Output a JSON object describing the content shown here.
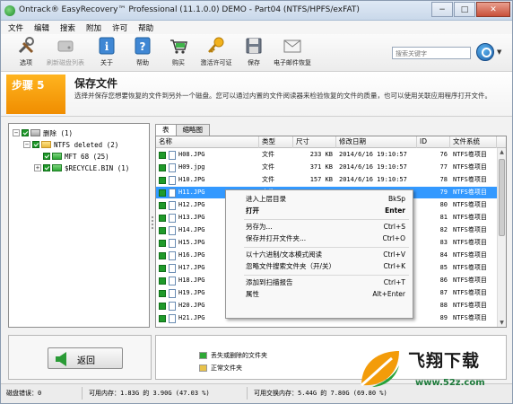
{
  "window": {
    "title": "Ontrack® EasyRecovery™ Professional (11.1.0.0) DEMO - Part04 (NTFS/HPFS/exFAT)",
    "min": "−",
    "max": "□",
    "close": "✕"
  },
  "menu": [
    "文件",
    "编辑",
    "搜索",
    "附加",
    "许可",
    "帮助"
  ],
  "toolbar": {
    "items": [
      {
        "label": "选项",
        "icon": "tools-icon"
      },
      {
        "label": "刷新磁盘列表",
        "icon": "refresh-disk-icon"
      },
      {
        "label": "关于",
        "icon": "info-icon"
      },
      {
        "label": "帮助",
        "icon": "help-icon"
      },
      {
        "label": "购买",
        "icon": "cart-icon"
      },
      {
        "label": "激活许可证",
        "icon": "key-icon"
      },
      {
        "label": "保存",
        "icon": "save-icon"
      },
      {
        "label": "电子邮件恢复",
        "icon": "email-icon"
      }
    ],
    "search_placeholder": "搜索关键字"
  },
  "step": {
    "badge": "步骤 5",
    "title": "保存文件",
    "description": "选择并保存您想要恢复的文件到另外一个磁盘。您可以通过内置的文件阅读器来检验恢复的文件的质量，也可以使用关联应用程序打开文件。"
  },
  "tree": [
    {
      "label": "删除 (1)",
      "expander": "−",
      "kind": "drive",
      "indent": 0
    },
    {
      "label": "NTFS deleted (2)",
      "expander": "−",
      "kind": "folder",
      "indent": 1
    },
    {
      "label": "MFT 68 (25)",
      "expander": "",
      "kind": "folder",
      "indent": 2
    },
    {
      "label": "$RECYCLE.BIN (1)",
      "expander": "+",
      "kind": "folder",
      "indent": 2
    }
  ],
  "tabs": [
    "表",
    "缩略图"
  ],
  "columns": [
    "名称",
    "类型",
    "尺寸",
    "修改日期",
    "ID",
    "文件系统"
  ],
  "rows": [
    {
      "name": "H08.JPG",
      "type": "文件",
      "size": "233 KB",
      "date": "2014/6/16 19:10:57",
      "id": "76",
      "fs": "NTFS卷项目"
    },
    {
      "name": "H09.jpg",
      "type": "文件",
      "size": "371 KB",
      "date": "2014/6/16 19:10:57",
      "id": "77",
      "fs": "NTFS卷项目"
    },
    {
      "name": "H10.JPG",
      "type": "文件",
      "size": "157 KB",
      "date": "2014/6/16 19:10:57",
      "id": "78",
      "fs": "NTFS卷项目"
    },
    {
      "name": "H11.JPG",
      "type": "文件",
      "size": "271 KB",
      "date": "2014/6/16 19:10:57",
      "id": "79",
      "fs": "NTFS卷项目"
    },
    {
      "name": "H12.JPG",
      "type": "",
      "size": "",
      "date": "",
      "id": "80",
      "fs": "NTFS卷项目"
    },
    {
      "name": "H13.JPG",
      "type": "",
      "size": "",
      "date": "",
      "id": "81",
      "fs": "NTFS卷项目"
    },
    {
      "name": "H14.JPG",
      "type": "",
      "size": "",
      "date": "",
      "id": "82",
      "fs": "NTFS卷项目"
    },
    {
      "name": "H15.JPG",
      "type": "",
      "size": "",
      "date": "",
      "id": "83",
      "fs": "NTFS卷项目"
    },
    {
      "name": "H16.JPG",
      "type": "",
      "size": "",
      "date": "",
      "id": "84",
      "fs": "NTFS卷项目"
    },
    {
      "name": "H17.JPG",
      "type": "",
      "size": "",
      "date": "",
      "id": "85",
      "fs": "NTFS卷项目"
    },
    {
      "name": "H18.JPG",
      "type": "",
      "size": "",
      "date": "",
      "id": "86",
      "fs": "NTFS卷项目"
    },
    {
      "name": "H19.JPG",
      "type": "",
      "size": "",
      "date": "",
      "id": "87",
      "fs": "NTFS卷项目"
    },
    {
      "name": "H20.JPG",
      "type": "",
      "size": "",
      "date": "",
      "id": "88",
      "fs": "NTFS卷项目"
    },
    {
      "name": "H21.JPG",
      "type": "",
      "size": "",
      "date": "",
      "id": "89",
      "fs": "NTFS卷项目"
    }
  ],
  "selected_row": 3,
  "context_menu": [
    {
      "label": "进入上层目录",
      "shortcut": "BkSp",
      "bold": false
    },
    {
      "label": "打开",
      "shortcut": "Enter",
      "bold": true
    },
    {
      "sep": true
    },
    {
      "label": "另存为...",
      "shortcut": "Ctrl+S",
      "bold": false
    },
    {
      "label": "保存并打开文件夹...",
      "shortcut": "Ctrl+O",
      "bold": false
    },
    {
      "sep": true
    },
    {
      "label": "以十六进制/文本模式阅读",
      "shortcut": "Ctrl+V",
      "bold": false
    },
    {
      "label": "忽略文件搜索文件夹（开/关）",
      "shortcut": "Ctrl+K",
      "bold": false
    },
    {
      "sep": true
    },
    {
      "label": "添加到扫描报告",
      "shortcut": "Ctrl+T",
      "bold": false
    },
    {
      "label": "属性",
      "shortcut": "Alt+Enter",
      "bold": false
    }
  ],
  "back_button": "返回",
  "legend": [
    {
      "label": "丢失或删除的文件夹",
      "color": "#2ea836"
    },
    {
      "label": "正常文件夹",
      "color": "#e8c24a"
    }
  ],
  "status": {
    "disk_errors": "磁盘错误：0",
    "mem": "可用内存：1.83G 的 3.90G (47.03 %)",
    "swap": "可用交换内存：5.44G 的 7.80G (69.80 %)"
  },
  "watermark": {
    "text": "飞翔下载",
    "url": "www.52z.com"
  },
  "colors": {
    "accent": "#f39c0a",
    "selection": "#3399ff",
    "check": "#1f9a2a"
  }
}
